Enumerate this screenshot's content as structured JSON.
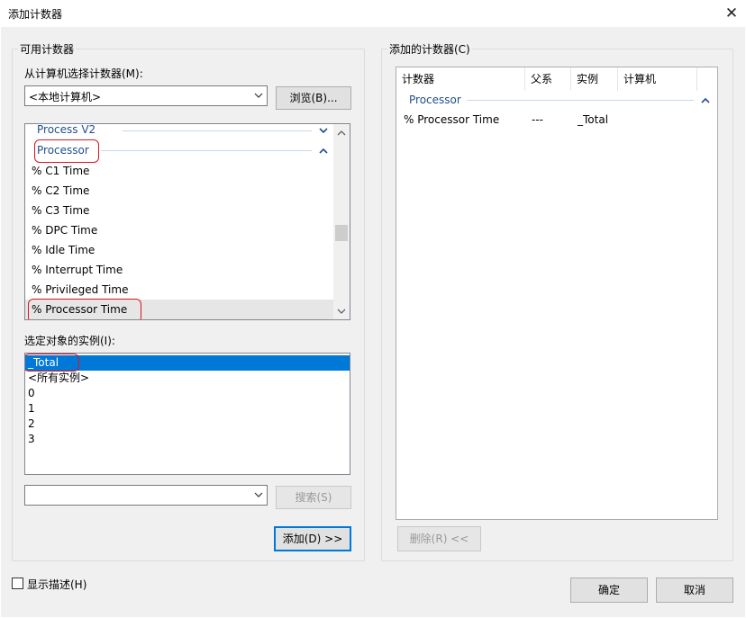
{
  "window": {
    "title": "添加计数器",
    "close_glyph": "✕"
  },
  "left_group": {
    "legend": "可用计数器",
    "computer_label": "从计算机选择计数器(M):",
    "computer_value": "<本地计算机>",
    "browse_button": "浏览(B)...",
    "counter_list": {
      "categories": [
        {
          "name": "Process V2",
          "state": "collapsed"
        },
        {
          "name": "Processor",
          "state": "expanded",
          "highlighted": true
        }
      ],
      "counters": [
        "% C1 Time",
        "% C2 Time",
        "% C3 Time",
        "% DPC Time",
        "% Idle Time",
        "% Interrupt Time",
        "% Privileged Time",
        "% Processor Time"
      ],
      "selected_counter": "% Processor Time"
    },
    "instances_label": "选定对象的实例(I):",
    "instances": [
      "_Total",
      "<所有实例>",
      "0",
      "1",
      "2",
      "3"
    ],
    "selected_instance": "_Total",
    "search_value": "",
    "search_button": "搜索(S)",
    "add_button": "添加(D) >>"
  },
  "right_group": {
    "legend": "添加的计数器(C)",
    "columns": [
      "计数器",
      "父系",
      "实例",
      "计算机"
    ],
    "category": "Processor",
    "rows": [
      {
        "counter": "% Processor Time",
        "parent": "---",
        "instance": "_Total",
        "computer": ""
      }
    ],
    "remove_button": "删除(R) <<"
  },
  "footer": {
    "show_description": "显示描述(H)",
    "show_description_checked": false,
    "ok_button": "确定",
    "cancel_button": "取消"
  },
  "colors": {
    "accent": "#0078d7",
    "highlight_ring": "#e0141e",
    "category_text": "#1f4e8c",
    "dialog_bg": "#f0f0f0"
  },
  "icons": {
    "close": "close-icon",
    "dropdown": "chevron-down-icon",
    "collapse": "chevron-up-icon",
    "expand": "chevron-down-icon"
  }
}
